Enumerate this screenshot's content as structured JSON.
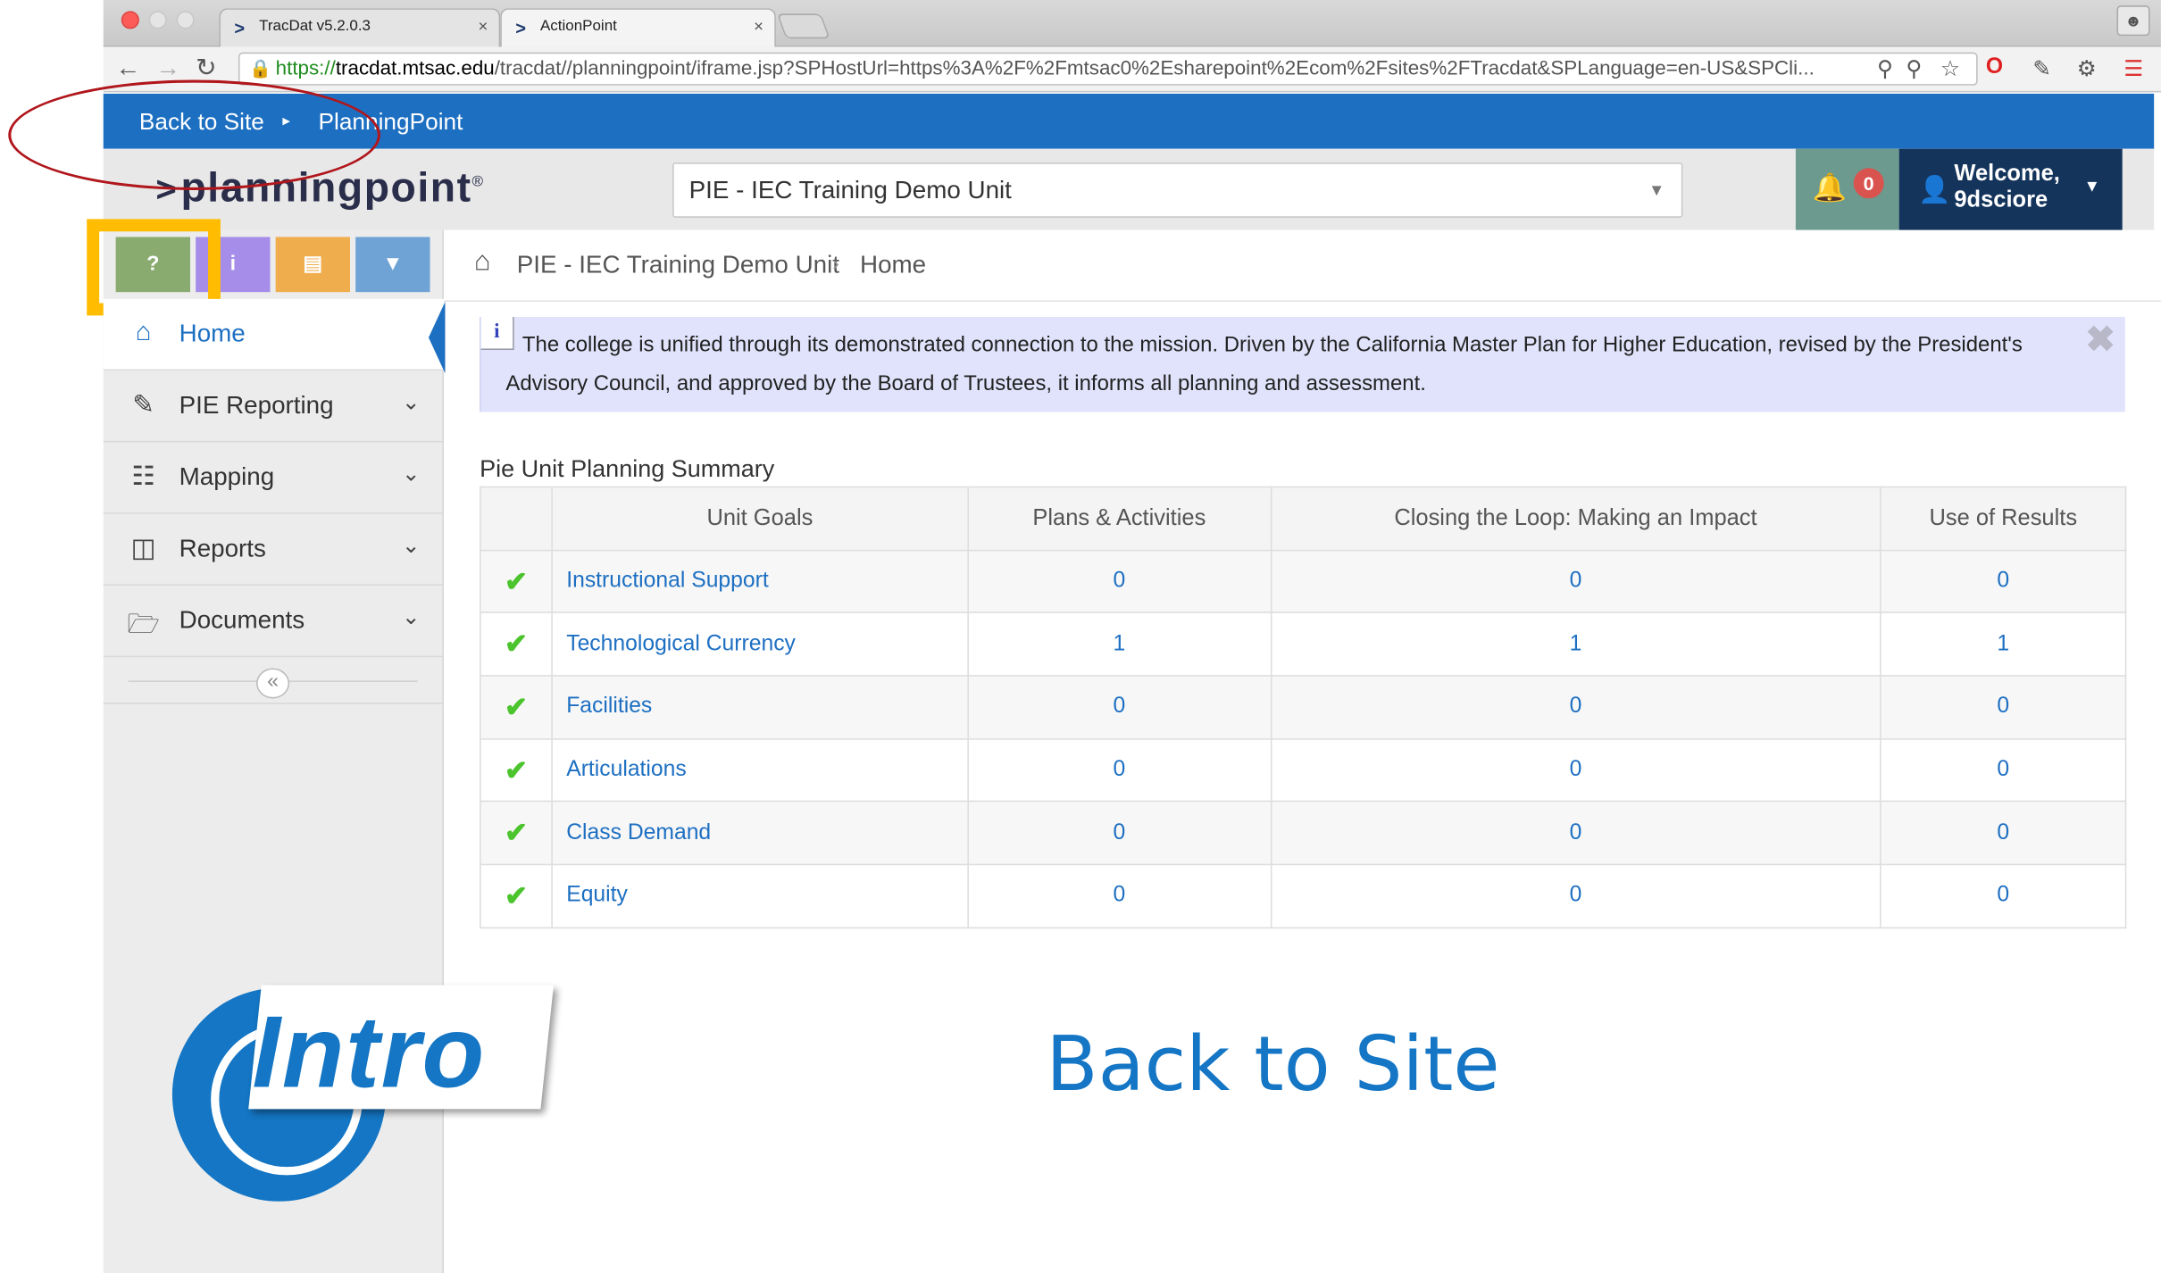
{
  "browser": {
    "tabs": [
      {
        "title": "TracDat v5.2.0.3",
        "close": "×"
      },
      {
        "title": "ActionPoint",
        "close": "×"
      }
    ],
    "url": {
      "scheme": "https://",
      "host": "tracdat.mtsac.edu",
      "path": "/tracdat//planningpoint/iframe.jsp?SPHostUrl=https%3A%2F%2Fmtsac0%2Esharepoint%2Ecom%2Fsites%2FTracdat&SPLanguage=en-US&SPCli..."
    }
  },
  "appbar": {
    "back_to_site": "Back to Site",
    "separator": "▸",
    "current": "PlanningPoint"
  },
  "header": {
    "logo_text": "planningpoint",
    "logo_mark": "®",
    "unit_selected": "PIE - IEC Training Demo Unit",
    "notification_count": "0",
    "welcome_line1": "Welcome,",
    "welcome_line2": "9dsciore"
  },
  "toolbar": {
    "help_label": "?",
    "info_label": "i",
    "colors": {
      "help": "#8aab6f",
      "info": "#a58de9",
      "notes": "#f0ad4e",
      "filter": "#6fa3d6"
    }
  },
  "sidebar": {
    "items": [
      {
        "label": "Home",
        "icon": "home-icon"
      },
      {
        "label": "PIE Reporting",
        "icon": "pencil-icon"
      },
      {
        "label": "Mapping",
        "icon": "sitemap-icon"
      },
      {
        "label": "Reports",
        "icon": "columns-icon"
      },
      {
        "label": "Documents",
        "icon": "folder-icon"
      }
    ],
    "collapse_label": "«"
  },
  "breadcrumb": {
    "unit": "PIE - IEC Training Demo Unit",
    "separator": "›",
    "page": "Home"
  },
  "info_message": {
    "line1": "The college is unified through its demonstrated connection to the mission. Driven by the California Master Plan for Higher Education, revised by the President's",
    "line2": "Advisory Council, and approved by the Board of Trustees, it informs all planning and assessment.",
    "close": "✖"
  },
  "summary": {
    "title": "Pie Unit Planning Summary",
    "columns": [
      "",
      "Unit Goals",
      "Plans & Activities",
      "Closing the Loop: Making an Impact",
      "Use of Results"
    ],
    "rows": [
      {
        "status": "✔",
        "goal": "Instructional Support",
        "plans": "0",
        "closing": "0",
        "use": "0"
      },
      {
        "status": "✔",
        "goal": "Technological Currency",
        "plans": "1",
        "closing": "1",
        "use": "1"
      },
      {
        "status": "✔",
        "goal": "Facilities",
        "plans": "0",
        "closing": "0",
        "use": "0"
      },
      {
        "status": "✔",
        "goal": "Articulations",
        "plans": "0",
        "closing": "0",
        "use": "0"
      },
      {
        "status": "✔",
        "goal": "Class Demand",
        "plans": "0",
        "closing": "0",
        "use": "0"
      },
      {
        "status": "✔",
        "goal": "Equity",
        "plans": "0",
        "closing": "0",
        "use": "0"
      }
    ]
  },
  "overlay": {
    "intro_text": "Intro",
    "caption": "Back to Site"
  }
}
